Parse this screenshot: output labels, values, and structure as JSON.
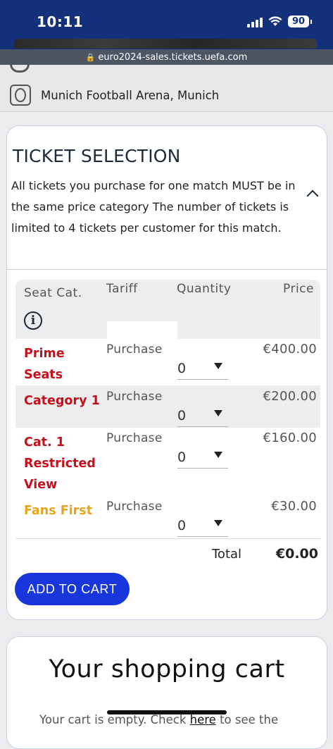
{
  "status_bar": {
    "time": "10:11",
    "battery": "90"
  },
  "browser": {
    "url": "euro2024-sales.tickets.uefa.com"
  },
  "venue": {
    "name": "Munich Football Arena, Munich"
  },
  "ticket_selection": {
    "title": "TICKET SELECTION",
    "description": "All tickets you purchase for one match MUST be in the same price category The number of tickets is limited to 4 tickets per customer for this match.",
    "headers": {
      "seat_cat": "Seat Cat.",
      "tariff": "Tariff",
      "quantity": "Quantity",
      "price": "Price"
    },
    "rows": [
      {
        "category": "Prime Seats",
        "tariff": "Purchase",
        "quantity": "0",
        "price": "€400.00",
        "color": "#c4101c"
      },
      {
        "category": "Category 1",
        "tariff": "Purchase",
        "quantity": "0",
        "price": "€200.00",
        "color": "#c4101c"
      },
      {
        "category": "Cat. 1 Restricted View",
        "tariff": "Purchase",
        "quantity": "0",
        "price": "€160.00",
        "color": "#c4101c"
      },
      {
        "category": "Fans First",
        "tariff": "Purchase",
        "quantity": "0",
        "price": "€30.00",
        "color": "#e2a71c"
      }
    ],
    "total_label": "Total",
    "total_value": "€0.00",
    "add_to_cart": "ADD TO CART"
  },
  "cart": {
    "title": "Your shopping cart",
    "note_prefix": "Your cart is empty. Check ",
    "note_link": "here",
    "note_suffix": " to see the"
  },
  "colors": {
    "header": "#13307a",
    "primary_button": "#1836dc",
    "category_red": "#c4101c",
    "category_gold": "#e2a71c"
  }
}
